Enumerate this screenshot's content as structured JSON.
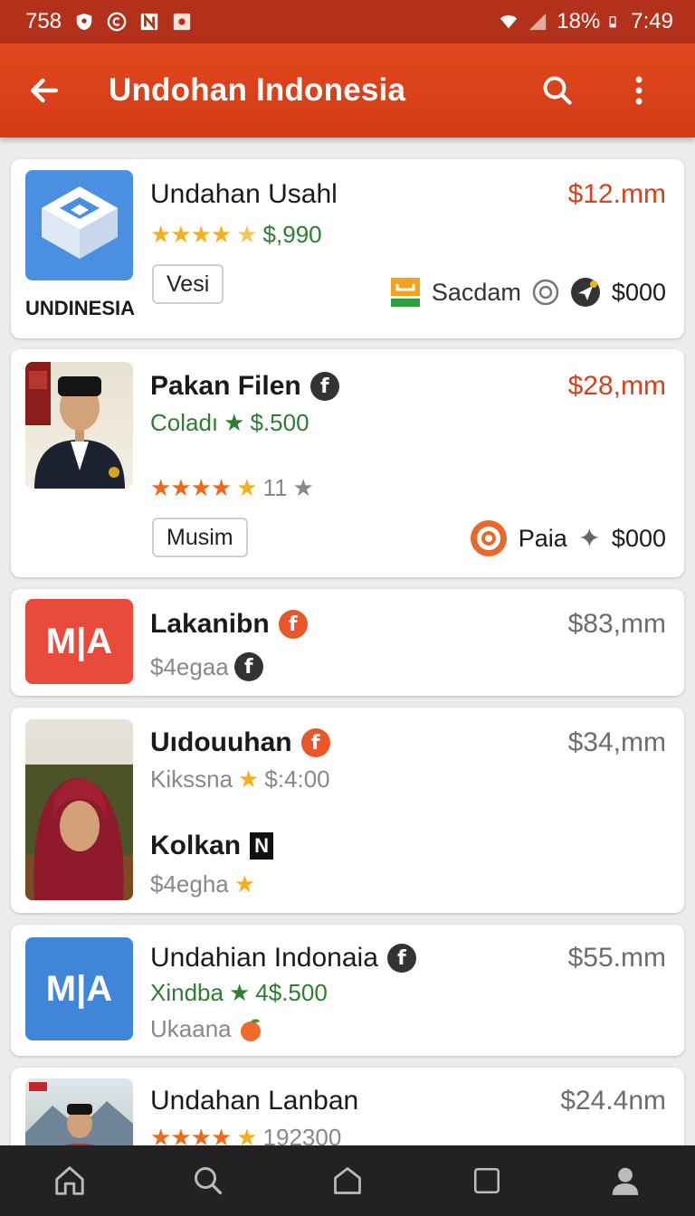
{
  "status_bar": {
    "time_left": "758",
    "battery": "18%",
    "time_right": "7:49"
  },
  "app_bar": {
    "title": "Undohan Indonesia",
    "icons": [
      "arrow-left-icon",
      "search-icon",
      "more-vert-icon"
    ]
  },
  "listings": [
    {
      "title": "Undahan Usahl",
      "price": "$12.mm",
      "rating_text": "$,990",
      "tag": "Vesi",
      "brand_label": "UNDINESIA",
      "vendor": "Sacdam",
      "amount": "$000"
    },
    {
      "title": "Pakan Filen",
      "price": "$28,mm",
      "subtitle": "Coladı",
      "subtitle_value": "$.500",
      "rating_count": "11",
      "tag": "Musim",
      "vendor": "Paia",
      "amount": "$000"
    },
    {
      "title": "Lakanibn",
      "price": "$83,mm",
      "subtitle": "$4egaa",
      "logo_text": "M|A"
    },
    {
      "title": "Uıdouuhan",
      "price": "$34,mm",
      "subtitle": "Kikssna",
      "subtitle_value": "$:4:00",
      "title2": "Kolkan",
      "badge2": "N",
      "subtitle2": "$4egha"
    },
    {
      "title": "Undahian Indonaia",
      "price": "$55.mm",
      "subtitle": "Xindba",
      "subtitle_value": "4$.500",
      "subtitle2": "Ukaana",
      "logo_text": "M|A"
    },
    {
      "title": "Undahan Lanban",
      "price": "$24.4nm",
      "rating_count": "192300"
    }
  ],
  "colors": {
    "app_bar": "#d9411c",
    "status_bar": "#b3311a",
    "price_red": "#d9411c",
    "green": "#2e7d32",
    "nav_bg": "#222222"
  },
  "bottom_nav": [
    "home-icon",
    "search-icon",
    "house-outline-icon",
    "square-icon",
    "profile-icon"
  ]
}
